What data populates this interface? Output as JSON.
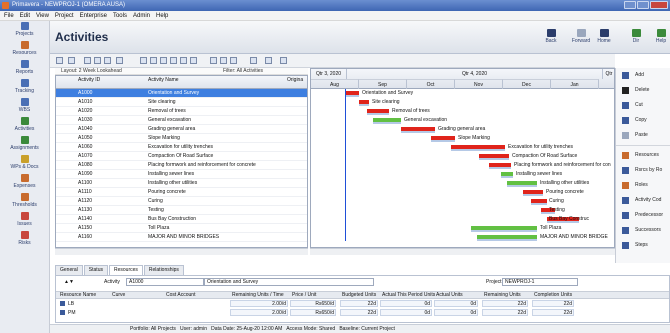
{
  "window": {
    "title": "Primavera - NEWPROJ-1 (OMERA AUSA)"
  },
  "menu": [
    "File",
    "Edit",
    "View",
    "Project",
    "Enterprise",
    "Tools",
    "Admin",
    "Help"
  ],
  "sidebar": [
    {
      "label": "Projects",
      "color": "#4a6fb5"
    },
    {
      "label": "Resources",
      "color": "#c86b2e"
    },
    {
      "label": "Reports",
      "color": "#4a6fb5"
    },
    {
      "label": "Tracking",
      "color": "#4a6fb5"
    },
    {
      "label": "WBS",
      "color": "#4a6fb5"
    },
    {
      "label": "Activities",
      "color": "#3b8a3b"
    },
    {
      "label": "Assignments",
      "color": "#3b8a3b"
    },
    {
      "label": "WPs & Docs",
      "color": "#c9a02b"
    },
    {
      "label": "Expenses",
      "color": "#c86b2e"
    },
    {
      "label": "Thresholds",
      "color": "#c86b2e"
    },
    {
      "label": "Issues",
      "color": "#c8463d"
    },
    {
      "label": "Risks",
      "color": "#c8463d"
    }
  ],
  "header": {
    "title": "Activities",
    "nav": [
      {
        "label": "Back",
        "icon": "back-arrow-icon",
        "color": "#2b3d6b"
      },
      {
        "label": "Forward",
        "icon": "forward-arrow-icon",
        "color": "#9aa7bd"
      },
      {
        "label": "Home",
        "icon": "home-icon",
        "color": "#2b3d6b"
      },
      {
        "label": "Dir",
        "icon": "directory-icon",
        "color": "#3b8a3b"
      },
      {
        "label": "Help",
        "icon": "help-icon",
        "color": "#3b8a3b"
      }
    ]
  },
  "filter": {
    "layout": "Layout: 2 Week Lookahead",
    "filter": "Filter: All Activities"
  },
  "grid": {
    "col_id": "Activity ID",
    "col_name": "Activity Name",
    "col_orig": "Origina",
    "rows": [
      {
        "id": "A1000",
        "name": "Orientation and Survey"
      },
      {
        "id": "A1010",
        "name": "Site clearing"
      },
      {
        "id": "A1020",
        "name": "Removal of trees"
      },
      {
        "id": "A1030",
        "name": "General excavation"
      },
      {
        "id": "A1040",
        "name": "Grading general area"
      },
      {
        "id": "A1050",
        "name": "Slope Marking"
      },
      {
        "id": "A1060",
        "name": "Excavation for utility trenches"
      },
      {
        "id": "A1070",
        "name": "Compaction Of Road Surface"
      },
      {
        "id": "A1080",
        "name": "Placing formwork and reinforcement for concrete"
      },
      {
        "id": "A1090",
        "name": "Installing sewer lines"
      },
      {
        "id": "A1100",
        "name": "Installing other utilities"
      },
      {
        "id": "A1110",
        "name": "Pouring concrete"
      },
      {
        "id": "A1120",
        "name": "Curing"
      },
      {
        "id": "A1130",
        "name": "Testing"
      },
      {
        "id": "A1140",
        "name": "Bus Bay Construction"
      },
      {
        "id": "A1150",
        "name": "Toll Plaza"
      },
      {
        "id": "A1160",
        "name": "MAJOR AND MINOR BRIDGES"
      }
    ]
  },
  "gantt": {
    "quarters": [
      "Qtr 3, 2020",
      "Qtr 4, 2020",
      "Qtr"
    ],
    "months": [
      "Aug",
      "Sep",
      "Oct",
      "Nov",
      "Dec",
      "Jan"
    ],
    "labels": [
      "Orientation and Survey",
      "Site clearing",
      "Removal of trees",
      "General excavation",
      "Grading general area",
      "Slope Marking",
      "Excavation for utility trenches",
      "Compaction Of Road Surface",
      "Placing formwork and reinforcement for con",
      "Installing sewer lines",
      "Installing other utilities",
      "Pouring concrete",
      "Curing",
      "Testing",
      "Bus Bay Construc",
      "Toll Plaza",
      "MAJOR AND MINOR BRIDGE"
    ]
  },
  "right_panel": {
    "group1": [
      {
        "label": "Add",
        "icon": "add-icon",
        "color": "#3b5a9a"
      },
      {
        "label": "Delete",
        "icon": "delete-icon",
        "color": "#222222"
      },
      {
        "label": "Cut",
        "icon": "cut-icon",
        "color": "#3b5a9a"
      },
      {
        "label": "Copy",
        "icon": "copy-icon",
        "color": "#3b5a9a"
      },
      {
        "label": "Paste",
        "icon": "paste-icon",
        "color": "#9aa7bd"
      }
    ],
    "group2": [
      {
        "label": "Resources",
        "icon": "resources-icon",
        "color": "#c86b2e"
      },
      {
        "label": "Rsrcs by Ro",
        "icon": "roles-resources-icon",
        "color": "#3b5a9a"
      },
      {
        "label": "Roles",
        "icon": "roles-icon",
        "color": "#c86b2e"
      },
      {
        "label": "Activity Cod",
        "icon": "activity-codes-icon",
        "color": "#3b5a9a"
      },
      {
        "label": "Predecessor",
        "icon": "predecessors-icon",
        "color": "#3b5a9a"
      },
      {
        "label": "Successors",
        "icon": "successors-icon",
        "color": "#3b5a9a"
      },
      {
        "label": "Steps",
        "icon": "steps-icon",
        "color": "#3b5a9a"
      }
    ]
  },
  "detail": {
    "tabs": [
      "General",
      "Status",
      "Resources",
      "Relationships"
    ],
    "activity_label": "Activity",
    "activity_id": "A1000",
    "activity_name": "Orientation and Survey",
    "project_label": "Project",
    "project_value": "NEWPROJ-1",
    "columns": [
      "Resource Name",
      "Curve",
      "Cost Account",
      "Remaining Units / Time",
      "Price / Unit",
      "Budgeted Units",
      "Actual This Period Units",
      "Actual Units",
      "Remaining Units",
      "Completion Units"
    ],
    "rows": [
      {
        "name": "LB",
        "curve": "",
        "cost": "",
        "rem_time": "2.00/d",
        "price": "Rs650/d",
        "budgeted": "22d",
        "atp": "0d",
        "actual": "0d",
        "remaining": "22d",
        "completion": "22d"
      },
      {
        "name": "PM",
        "curve": "",
        "cost": "",
        "rem_time": "2.00/d",
        "price": "Rs650/d",
        "budgeted": "22d",
        "atp": "0d",
        "actual": "0d",
        "remaining": "22d",
        "completion": "22d"
      }
    ]
  },
  "status": {
    "portfolio": "Portfolio: All Projects",
    "user": "User: admin",
    "data_date": "Data Date: 25-Aug-20 12:00 AM",
    "access": "Access Mode: Shared",
    "baseline": "Baseline: Current Project"
  }
}
